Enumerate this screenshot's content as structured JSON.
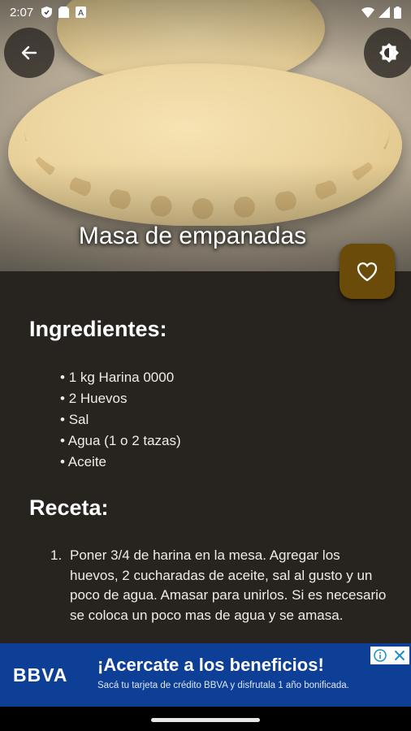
{
  "status_bar": {
    "time": "2:07",
    "icons": [
      "shield-icon",
      "sim-icon",
      "notification-a-icon",
      "wifi-icon",
      "signal-icon",
      "battery-icon"
    ]
  },
  "header": {
    "back_icon": "arrow-left-icon",
    "theme_icon": "brightness-icon",
    "title": "Masa de empanadas",
    "favorite_icon": "heart-outline-icon",
    "accent_color": "#6b4b0a"
  },
  "ingredients": {
    "heading": "Ingredientes:",
    "items": [
      "1 kg Harina 0000",
      "2 Huevos",
      "Sal",
      "Agua (1 o 2 tazas)",
      "Aceite"
    ]
  },
  "recipe": {
    "heading": "Receta:",
    "steps": [
      {
        "number": "1.",
        "text": "Poner 3/4 de harina en la mesa. Agregar los huevos, 2 cucharadas de aceite, sal al gusto y un poco de agua. Amasar para unirlos. Si es necesario se coloca un poco mas de agua y se amasa."
      }
    ]
  },
  "ad": {
    "brand": "BBVA",
    "headline": "¡Acercate a los beneficios!",
    "subtext": "Sacá tu tarjeta de crédito BBVA y disfrutala 1 año bonificada.",
    "background_color": "#0d3f96"
  },
  "colors": {
    "content_bg": "#27231f"
  }
}
